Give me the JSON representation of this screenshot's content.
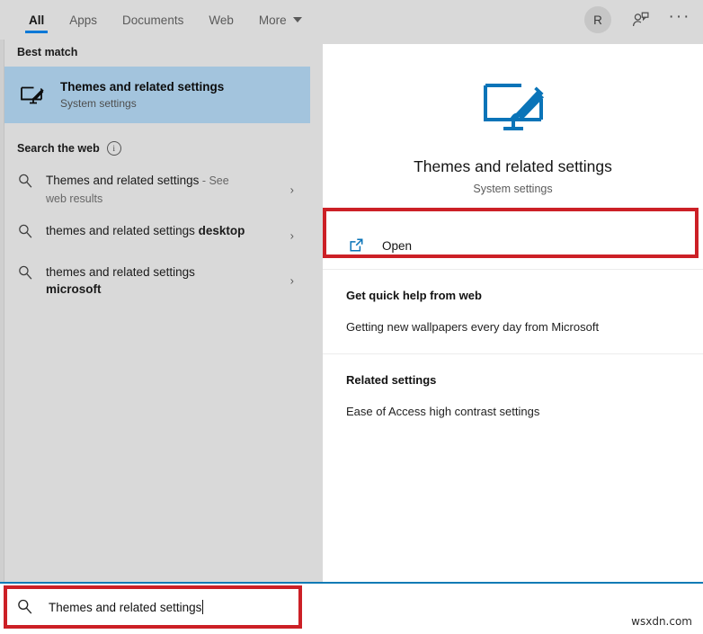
{
  "header": {
    "tabs": [
      {
        "label": "All",
        "active": true
      },
      {
        "label": "Apps",
        "active": false
      },
      {
        "label": "Documents",
        "active": false
      },
      {
        "label": "Web",
        "active": false
      },
      {
        "label": "More",
        "active": false,
        "has_caret": true
      }
    ],
    "avatar_initial": "R",
    "feedback_icon": "person-feedback-icon",
    "overflow_label": "···"
  },
  "left_pane": {
    "best_match_label": "Best match",
    "best_match": {
      "title": "Themes and related settings",
      "subtitle": "System settings",
      "icon": "monitor-paintbrush-icon"
    },
    "search_web_label": "Search the web",
    "search_web_info_icon": "info-icon",
    "web_results": [
      {
        "text": "Themes and related settings",
        "suffix": " - See web results",
        "bold_suffix": "",
        "chevron": "›"
      },
      {
        "text": "themes and related settings ",
        "suffix": "",
        "bold_suffix": "desktop",
        "chevron": "›"
      },
      {
        "text": "themes and related settings ",
        "suffix": "",
        "bold_suffix": "microsoft",
        "chevron": "›"
      }
    ]
  },
  "right_pane": {
    "title": "Themes and related settings",
    "subtitle": "System settings",
    "icon": "monitor-paintbrush-icon",
    "open_action": {
      "label": "Open",
      "icon": "external-link-icon"
    },
    "quick_help": {
      "title": "Get quick help from web",
      "body": "Getting new wallpapers every day from Microsoft"
    },
    "related_settings": {
      "title": "Related settings",
      "body": "Ease of Access high contrast settings"
    }
  },
  "search_bar": {
    "value": "Themes and related settings",
    "icon": "search-icon"
  },
  "watermark": "wsxdn.com",
  "colors": {
    "accent_blue": "#0078d7",
    "highlight_blue": "#a3c4dd",
    "annotation_red": "#cc2026",
    "panel_gray": "#d9d9d9",
    "icon_blue": "#0a74b8"
  }
}
